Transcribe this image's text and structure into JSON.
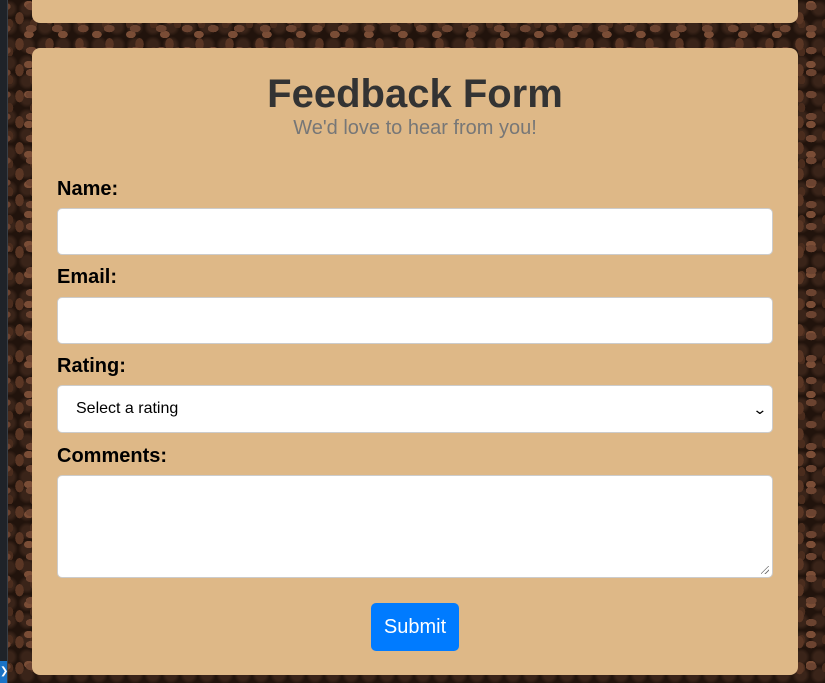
{
  "form": {
    "title": "Feedback Form",
    "subtitle": "We'd love to hear from you!",
    "name_label": "Name:",
    "name_value": "",
    "email_label": "Email:",
    "email_value": "",
    "rating_label": "Rating:",
    "rating_selected": "Select a rating",
    "comments_label": "Comments:",
    "comments_value": "",
    "submit_label": "Submit"
  },
  "colors": {
    "card_background": "#deb887",
    "title_text": "#333333",
    "subtitle_text": "#777777",
    "submit_button": "#007bff"
  },
  "icons": {
    "select_arrow": "chevron-down-icon",
    "textarea_resize": "resize-grip-icon"
  }
}
